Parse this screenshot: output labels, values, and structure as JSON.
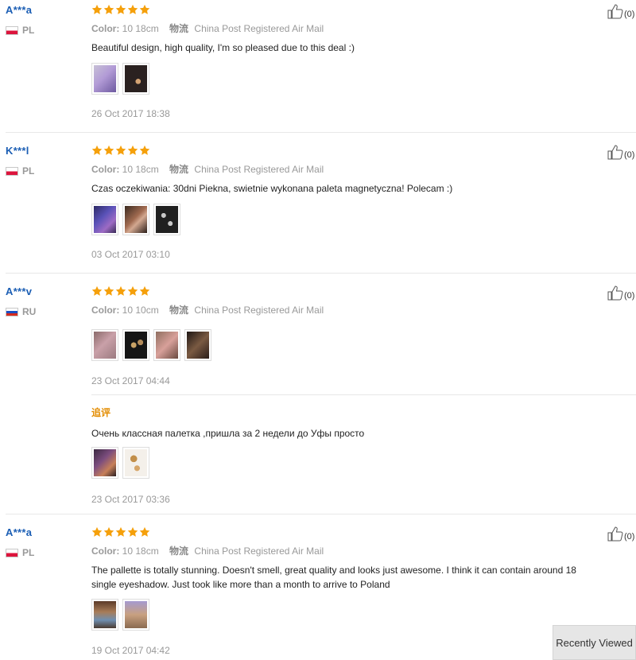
{
  "reviews": [
    {
      "user": "A***a",
      "country": "PL",
      "color_label": "Color:",
      "color_value": "10 18cm",
      "shipping_label": "物流",
      "shipping_value": "China Post Registered Air Mail",
      "text": "Beautiful design, high quality, I'm so pleased due to this deal :)",
      "date": "26 Oct 2017 18:38",
      "helpful_count": "(0)"
    },
    {
      "user": "K***l",
      "country": "PL",
      "color_label": "Color:",
      "color_value": "10 18cm",
      "shipping_label": "物流",
      "shipping_value": "China Post Registered Air Mail",
      "text": "Czas oczekiwania: 30dni Piekna, swietnie wykonana paleta magnetyczna! Polecam :)",
      "date": "03 Oct 2017 03:10",
      "helpful_count": "(0)"
    },
    {
      "user": "A***v",
      "country": "RU",
      "color_label": "Color:",
      "color_value": "10 10cm",
      "shipping_label": "物流",
      "shipping_value": "China Post Registered Air Mail",
      "text": "",
      "date": "23 Oct 2017 04:44",
      "helpful_count": "(0)",
      "followup": {
        "label": "追评",
        "text": "Очень классная палетка ,пришла за 2 недели до Уфы просто",
        "date": "23 Oct 2017 03:36"
      }
    },
    {
      "user": "A***a",
      "country": "PL",
      "color_label": "Color:",
      "color_value": "10 18cm",
      "shipping_label": "物流",
      "shipping_value": "China Post Registered Air Mail",
      "text": "The pallette is totally stunning. Doesn't smell, great quality and looks just awesome. I think it can contain around 18 single eyeshadow. Just took like more than a month to arrive to Poland",
      "date": "19 Oct 2017 04:42",
      "helpful_count": "(0)"
    }
  ],
  "rating_stars": 5,
  "colors": {
    "star": "#f5a00b",
    "username": "#1b5eb4",
    "followup": "#e38c00"
  },
  "recently_viewed_label": "Recently Viewed"
}
